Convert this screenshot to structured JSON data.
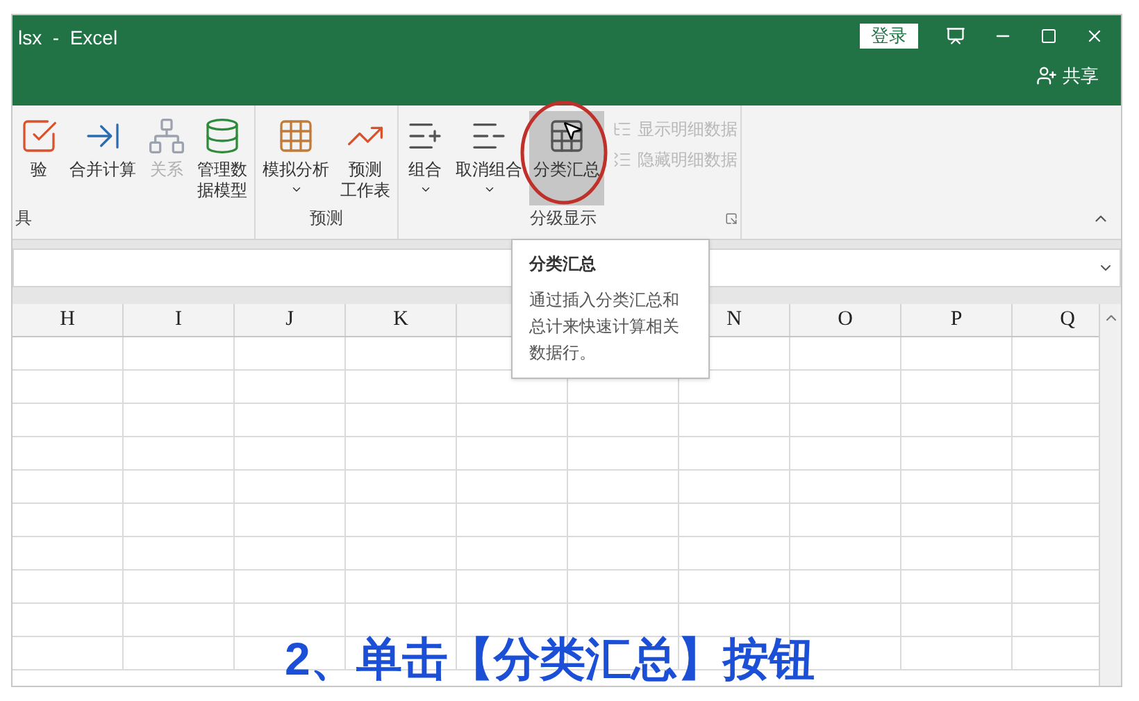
{
  "title_bar": {
    "title": "lsx  -  Excel",
    "sign_in": "登录",
    "share": "共享"
  },
  "ribbon": {
    "groups": [
      {
        "label": "具",
        "buttons": [
          {
            "kind": "validate",
            "lines": [
              "验"
            ],
            "disabled": false,
            "hovered": false,
            "dropdown": false
          },
          {
            "kind": "consolidate",
            "lines": [
              "合并计算"
            ],
            "disabled": false,
            "hovered": false,
            "dropdown": false
          },
          {
            "kind": "relations",
            "lines": [
              "关系"
            ],
            "disabled": true,
            "hovered": false,
            "dropdown": false
          },
          {
            "kind": "datamodel",
            "lines": [
              "管理数",
              "据模型"
            ],
            "disabled": false,
            "hovered": false,
            "dropdown": false
          }
        ]
      },
      {
        "label": "预测",
        "buttons": [
          {
            "kind": "whatif",
            "lines": [
              "模拟分析"
            ],
            "disabled": false,
            "hovered": false,
            "dropdown": true
          },
          {
            "kind": "forecast",
            "lines": [
              "预测",
              "工作表"
            ],
            "disabled": false,
            "hovered": false,
            "dropdown": false
          }
        ]
      },
      {
        "label": "分级显示",
        "buttons": [
          {
            "kind": "group",
            "lines": [
              "组合"
            ],
            "disabled": false,
            "hovered": false,
            "dropdown": true
          },
          {
            "kind": "ungroup",
            "lines": [
              "取消组合"
            ],
            "disabled": false,
            "hovered": false,
            "dropdown": true
          },
          {
            "kind": "subtotal",
            "lines": [
              "分类汇总"
            ],
            "disabled": false,
            "hovered": true,
            "dropdown": false
          }
        ],
        "small_buttons": [
          {
            "kind": "show",
            "label": "显示明细数据",
            "disabled": true
          },
          {
            "kind": "hide",
            "label": "隐藏明细数据",
            "disabled": true
          }
        ]
      }
    ]
  },
  "tooltip": {
    "title": "分类汇总",
    "body": "通过插入分类汇总和总计来快速计算相关数据行。"
  },
  "columns_left": [
    "H",
    "I",
    "J",
    "K"
  ],
  "columns_right": [
    "N",
    "O",
    "P",
    "Q"
  ],
  "caption": "2、单击【分类汇总】按钮"
}
